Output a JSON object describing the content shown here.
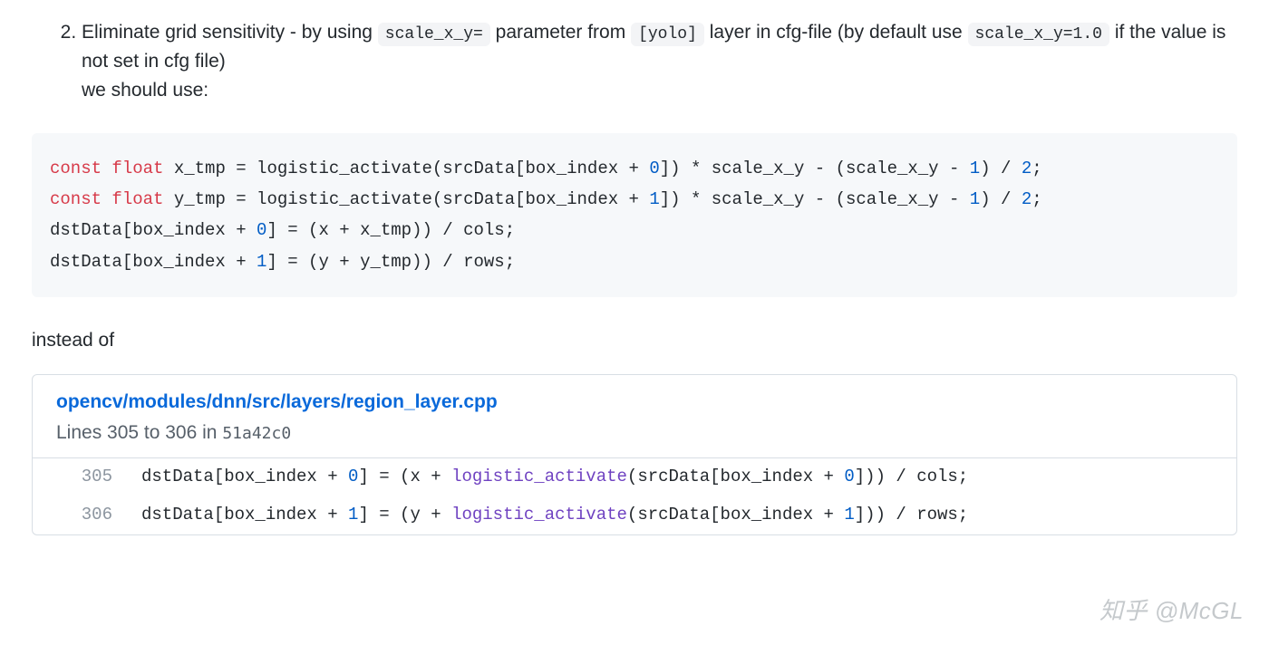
{
  "list": {
    "item2": {
      "text_parts": {
        "t1": "Eliminate grid sensitivity - by using ",
        "c1": "scale_x_y=",
        "t2": " parameter from ",
        "c2": "[yolo]",
        "t3": " layer in cfg-file (by default use ",
        "c3": "scale_x_y=1.0",
        "t4": " if the value is not set in cfg file)",
        "t5": "we should use:"
      }
    }
  },
  "code1": {
    "l1_kw1": "const ",
    "l1_kw2": "float",
    "l1_rest": " x_tmp = logistic_activate(srcData[box_index + ",
    "l1_n0": "0",
    "l1_mid": "]) * scale_x_y - (scale_x_y - ",
    "l1_n1": "1",
    "l1_end": ") / ",
    "l1_n2": "2",
    "l1_semi": ";",
    "l2_kw1": "const ",
    "l2_kw2": "float",
    "l2_rest": " y_tmp = logistic_activate(srcData[box_index + ",
    "l2_n0": "1",
    "l2_mid": "]) * scale_x_y - (scale_x_y - ",
    "l2_n1": "1",
    "l2_end": ") / ",
    "l2_n2": "2",
    "l2_semi": ";",
    "l3_a": "dstData[box_index + ",
    "l3_n": "0",
    "l3_b": "] = (x + x_tmp)) / cols;",
    "l4_a": "dstData[box_index + ",
    "l4_n": "1",
    "l4_b": "] = (y + y_tmp)) / rows;"
  },
  "instead": "instead of",
  "snippet": {
    "path": "opencv/modules/dnn/src/layers/region_layer.cpp",
    "lines_prefix": "Lines 305 to 306 in ",
    "sha": "51a42c0",
    "rows": {
      "r1_no": "305",
      "r1_a": "dstData[box_index + ",
      "r1_n1": "0",
      "r1_b": "] = (x + ",
      "r1_fn": "logistic_activate",
      "r1_c": "(srcData[box_index + ",
      "r1_n2": "0",
      "r1_d": "])) / cols;",
      "r2_no": "306",
      "r2_a": "dstData[box_index + ",
      "r2_n1": "1",
      "r2_b": "] = (y + ",
      "r2_fn": "logistic_activate",
      "r2_c": "(srcData[box_index + ",
      "r2_n2": "1",
      "r2_d": "])) / rows;"
    }
  },
  "watermark": "知乎 @McGL"
}
